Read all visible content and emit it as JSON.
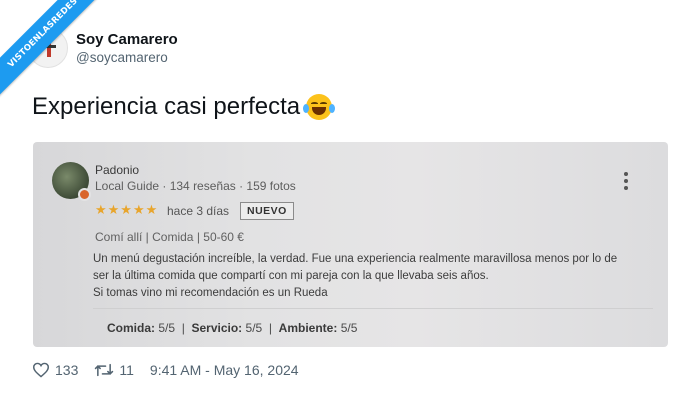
{
  "watermark": "VISTOENLASREDES",
  "author": {
    "name": "Soy Camarero",
    "handle": "@soycamarero"
  },
  "tweet": {
    "text": "Experiencia casi perfecta",
    "emoji": "face-with-tears-of-joy"
  },
  "review": {
    "reviewer": "Padonio",
    "meta": "Local Guide · 134 reseñas · 159 fotos",
    "stars": "★★★★★",
    "time_ago": "hace 3 días",
    "badge": "NUEVO",
    "details": "Comí allí  |  Comida  |  50-60 €",
    "text_lines": [
      "Un menú degustación increíble, la verdad. Fue una experiencia realmente maravillosa menos por lo de",
      "ser la última comida que compartí con mi pareja con la que llevaba seis años.",
      "Si tomas vino mi recomendación es un Rueda"
    ],
    "ratings": [
      {
        "label": "Comida:",
        "value": "5/5"
      },
      {
        "label": "Servicio:",
        "value": "5/5"
      },
      {
        "label": "Ambiente:",
        "value": "5/5"
      }
    ]
  },
  "stats": {
    "likes": "133",
    "retweets": "11",
    "timestamp": "9:41 AM - May 16, 2024"
  },
  "colors": {
    "ribbon": "#1d9bf0",
    "stars": "#e8a52c",
    "muted": "#536471"
  }
}
